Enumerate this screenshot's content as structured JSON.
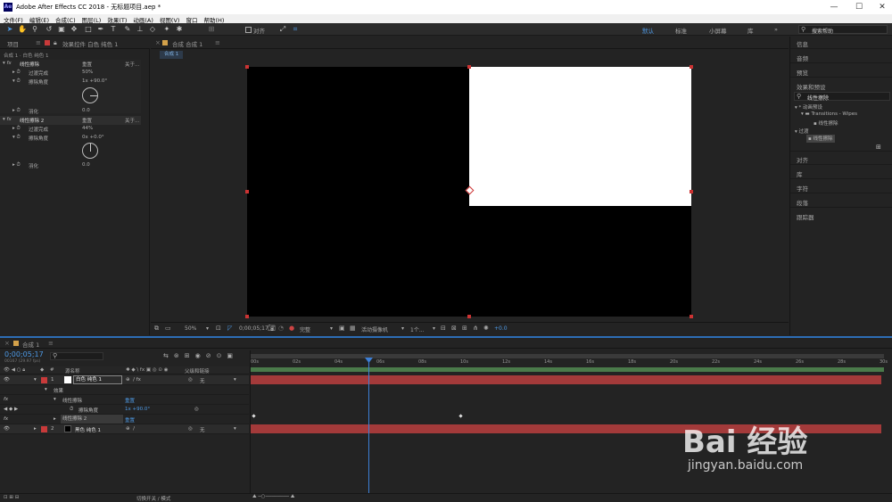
{
  "window": {
    "title": "Adobe After Effects CC 2018 - 无标题项目.aep *",
    "app_badge": "Ae"
  },
  "menu": [
    "文件(F)",
    "编辑(E)",
    "合成(C)",
    "图层(L)",
    "效果(T)",
    "动画(A)",
    "视图(V)",
    "窗口",
    "帮助(H)"
  ],
  "toolbar": {
    "align_label": "对齐",
    "workspaces": [
      "默认",
      "标准",
      "小屏幕",
      "库"
    ],
    "active_workspace": "默认",
    "search_placeholder": "搜索帮助"
  },
  "left_panel": {
    "tab_project": "项目",
    "tab_effects": "效果控件 白色 纯色 1",
    "breadcrumb": "合成 1 · 白色 纯色 1",
    "effects": [
      {
        "name": "线性擦除",
        "reset": "重置",
        "about": "关于...",
        "params": [
          {
            "label": "过渡完成",
            "value": "50%"
          },
          {
            "label": "擦除角度",
            "value": "1x +90.0°"
          },
          {
            "label": "羽化",
            "value": "0.0"
          }
        ]
      },
      {
        "name": "线性擦除 2",
        "reset": "重置",
        "about": "关于...",
        "params": [
          {
            "label": "过渡完成",
            "value": "44%"
          },
          {
            "label": "擦除角度",
            "value": "0x +0.0°"
          },
          {
            "label": "羽化",
            "value": "0.0"
          }
        ]
      }
    ]
  },
  "comp_panel": {
    "tab": "合成 合成 1",
    "sub_tab": "合成 1",
    "footer": {
      "zoom": "50%",
      "timecode": "0;00;05;17",
      "quality": "完整",
      "camera": "活动摄像机",
      "views": "1个...",
      "exposure": "+0.0"
    }
  },
  "right_panel": {
    "items_top": [
      "信息",
      "音频",
      "预览"
    ],
    "effects_presets": "效果和预设",
    "search_value": "线性擦除",
    "tree": [
      {
        "label": "* 动画预设",
        "level": 0
      },
      {
        "label": "Transitions - Wipes",
        "level": 1
      },
      {
        "label": "线性擦除",
        "level": 2
      },
      {
        "label": "过渡",
        "level": 0
      },
      {
        "label": "线性擦除",
        "level": 1
      }
    ],
    "items_bottom": [
      "对齐",
      "库",
      "字符",
      "段落",
      "跟踪器"
    ]
  },
  "timeline": {
    "tab": "合成 1",
    "timecode": "0;00;05;17",
    "fps": "00167 (29.97 fps)",
    "col_header": "源名称",
    "parent_header": "父级和链接",
    "layers": [
      {
        "num": "1",
        "name": "白色 纯色 1",
        "color": "#c83a3a",
        "parent": "无"
      },
      {
        "num": "2",
        "name": "黑色 纯色 1",
        "color": "#c83a3a",
        "parent": "无"
      }
    ],
    "sub_rows": [
      "效果",
      "线性擦除",
      "擦除角度",
      "线性擦除 2"
    ],
    "reset": "重置",
    "angle_value": "1x +90.0°",
    "ticks": [
      "00s",
      "02s",
      "04s",
      "06s",
      "08s",
      "10s",
      "12s",
      "14s",
      "16s",
      "18s",
      "20s",
      "22s",
      "24s",
      "26s",
      "28s",
      "30s"
    ],
    "footer": "切换开关 / 模式"
  },
  "watermark": {
    "brand": "Bai 经验",
    "url": "jingyan.baidu.com"
  }
}
